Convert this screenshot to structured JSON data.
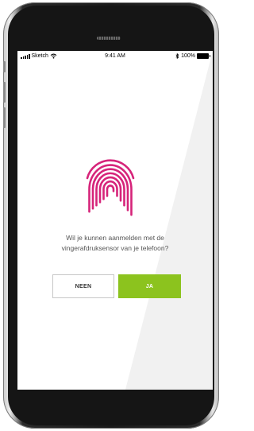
{
  "status_bar": {
    "carrier": "Sketch",
    "time": "9:41 AM",
    "battery": "100%",
    "battery_level": 1.0
  },
  "prompt": {
    "line1": "Wil je kunnen aanmelden met de",
    "line2": "vingerafdruksensor van je telefoon?"
  },
  "buttons": {
    "no": "NEEN",
    "yes": "JA"
  },
  "colors": {
    "fingerprint": "#d6247a",
    "accent": "#8cc31e",
    "button_border": "#c7c7c7",
    "text": "#555555"
  },
  "icons": {
    "fingerprint": "fingerprint-icon",
    "wifi": "wifi-icon",
    "bluetooth": "bluetooth-icon",
    "signal": "signal-icon",
    "battery": "battery-icon"
  }
}
